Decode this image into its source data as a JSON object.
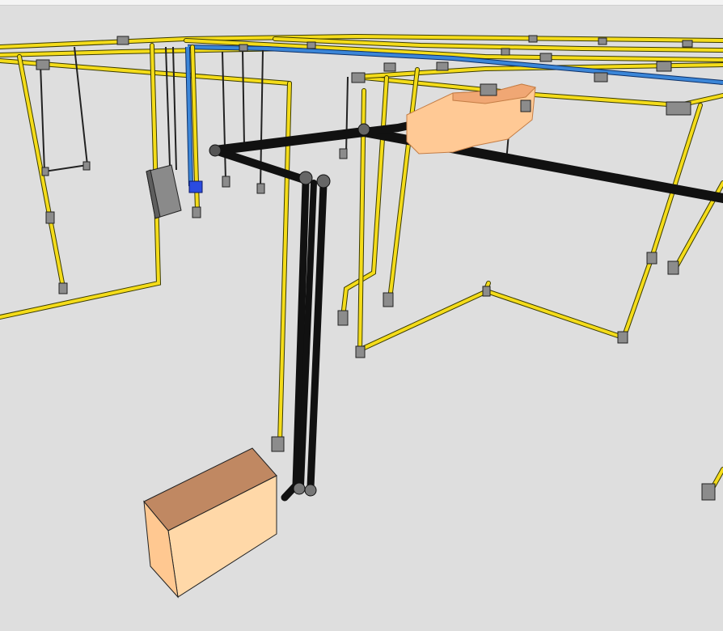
{
  "scene": {
    "background_color": "#dedede",
    "colors": {
      "conduit_yellow": "#f4dc1a",
      "conduit_blue": "#3b86d8",
      "pipe_black": "#111111",
      "equipment_peach": "#ffcc99",
      "junction_box_gray": "#8c8c8c",
      "panel_gray": "#8a8a8a",
      "small_blue_device": "#2a4be0"
    },
    "elements": [
      "electrical-conduit-network",
      "black-pipe-run",
      "peach-equipment-unit-floor",
      "peach-equipment-unit-ceiling",
      "electrical-panel",
      "junction-boxes"
    ]
  }
}
